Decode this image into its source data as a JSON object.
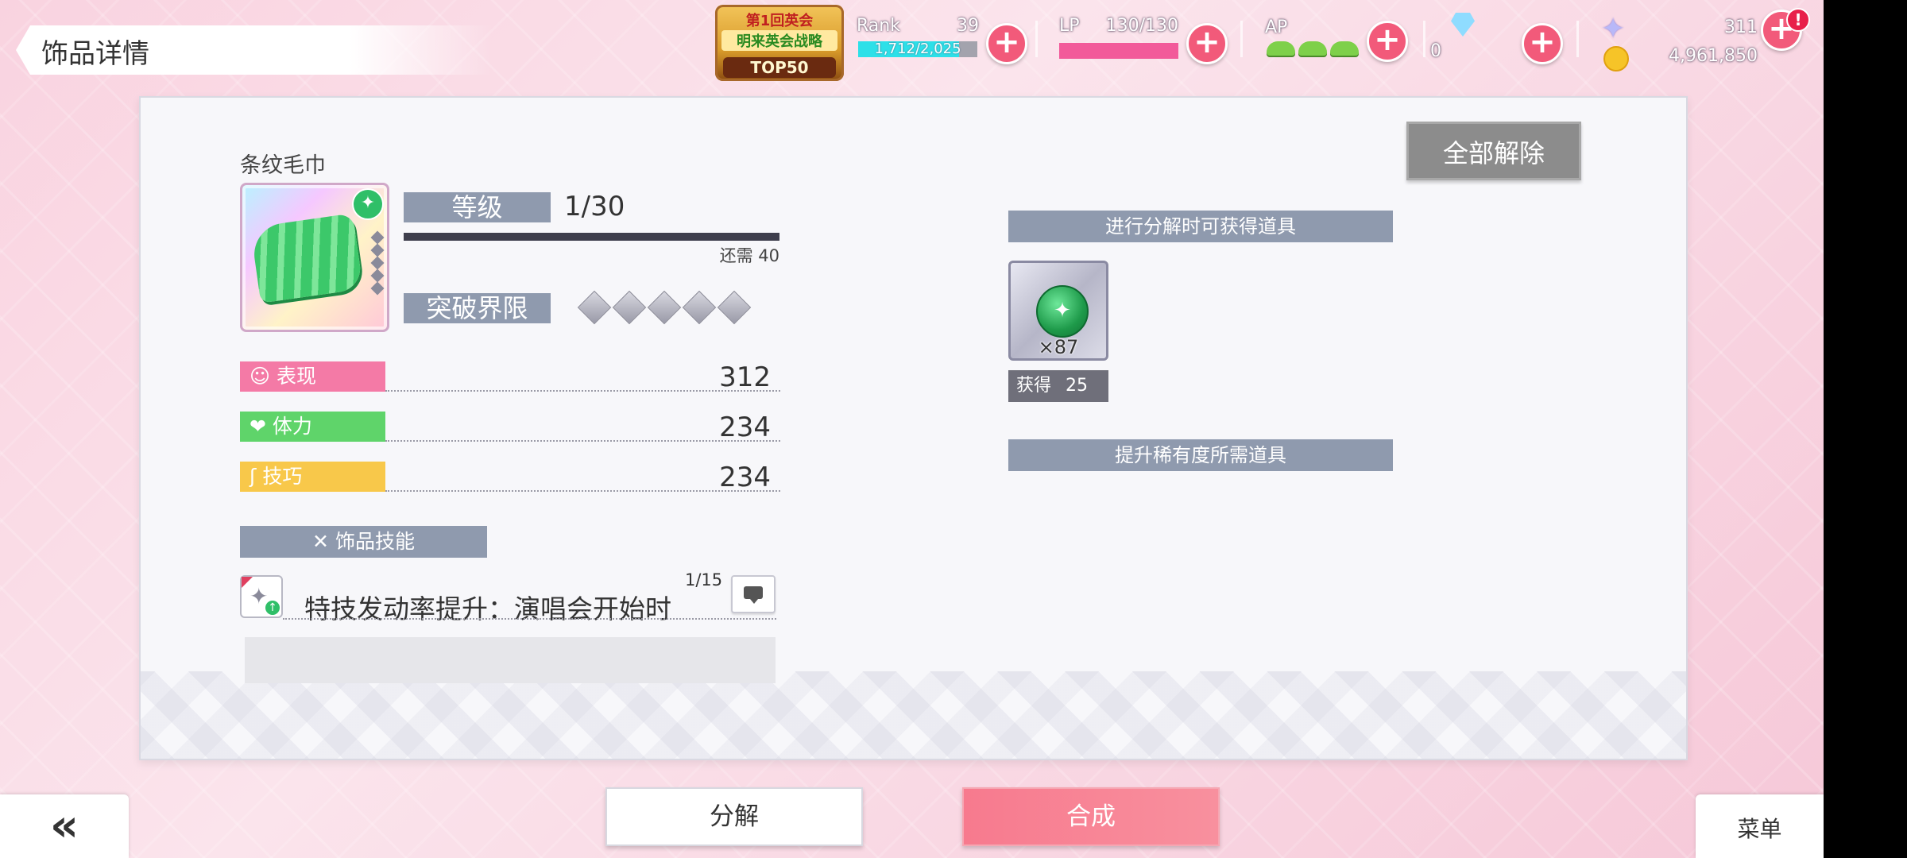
{
  "header": {
    "title": "饰品详情",
    "event": {
      "line1": "第1回英会",
      "line2": "明来英会战略",
      "rank_badge": "TOP50"
    },
    "rank": {
      "label": "Rank",
      "value": "39",
      "exp": "1,712/2,025",
      "progress": 0.845
    },
    "lp": {
      "label": "LP",
      "value": "130/130",
      "progress": 1.0
    },
    "ap": {
      "label": "AP"
    },
    "gems": {
      "value": "0"
    },
    "stars": {
      "value": "311"
    },
    "gold": {
      "value": "4,961,850"
    },
    "notification": "!"
  },
  "item": {
    "name": "条纹毛巾",
    "level_label": "等级",
    "level_value": "1/30",
    "level_need": "还需 40",
    "limit_label": "突破界限"
  },
  "stats": [
    {
      "icon": "☺",
      "label": "表现",
      "value": "312",
      "color": "#f47aa6"
    },
    {
      "icon": "❤",
      "label": "体力",
      "value": "234",
      "color": "#5fd46a"
    },
    {
      "icon": "ʃ",
      "label": "技巧",
      "value": "234",
      "color": "#f8c84a"
    }
  ],
  "skill": {
    "header": "饰品技能",
    "level": "1/15",
    "text": "特技发动率提升：演唱会开始时"
  },
  "right": {
    "release_all": "全部解除",
    "decompose_header": "进行分解时可获得道具",
    "material_count": "×87",
    "obtain_label": "获得",
    "obtain_value": "25",
    "rarity_header": "提升稀有度所需道具"
  },
  "footer": {
    "back": "«",
    "decompose": "分解",
    "synthesize": "合成",
    "menu": "菜单"
  }
}
